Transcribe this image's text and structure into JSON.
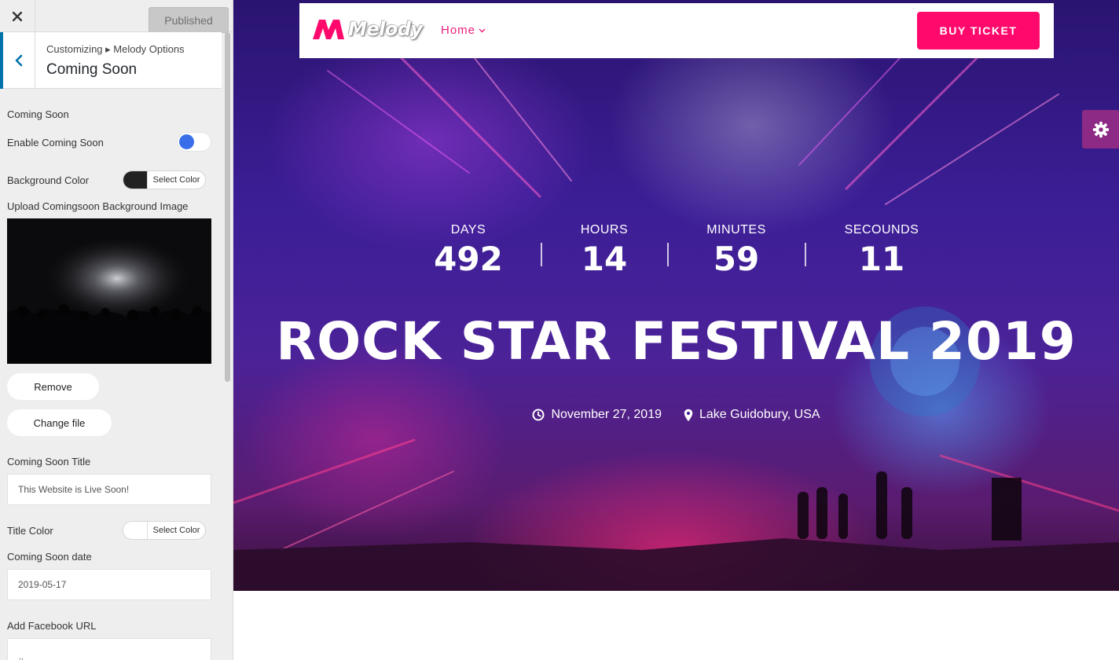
{
  "panel": {
    "publish_label": "Published",
    "breadcrumb": "Customizing ▸ Melody Options",
    "section_title": "Coming Soon",
    "controls": {
      "heading": "Coming Soon",
      "enable_label": "Enable Coming Soon",
      "enable_state": true,
      "bg_color_label": "Background Color",
      "select_color": "Select Color",
      "bg_color_value": "#222222",
      "upload_label": "Upload Comingsoon Background Image",
      "remove_label": "Remove",
      "change_file_label": "Change file",
      "title_label": "Coming Soon Title",
      "title_value": "This Website is Live Soon!",
      "title_color_label": "Title Color",
      "title_color_value": "#ffffff",
      "date_label": "Coming Soon date",
      "date_value": "2019-05-17",
      "facebook_label": "Add Facebook URL",
      "facebook_value": "#"
    }
  },
  "preview": {
    "logo_text": "Melody",
    "nav_home": "Home",
    "buy_ticket": "BUY TICKET",
    "countdown": [
      {
        "label": "DAYS",
        "value": "492"
      },
      {
        "label": "HOURS",
        "value": "14"
      },
      {
        "label": "MINUTES",
        "value": "59"
      },
      {
        "label": "SECOUNDS",
        "value": "11"
      }
    ],
    "event_title": "ROCK STAR FESTIVAL 2019",
    "event_date": "November 27, 2019",
    "event_location": "Lake Guidobury, USA"
  },
  "colors": {
    "accent_pink": "#ff0a6c",
    "nav_pink": "#ec1c7c",
    "toggle_blue": "#3a6ee8",
    "wp_blue": "#0073aa",
    "settings_purple": "#8c2a86"
  },
  "icons": {
    "close": "close-icon",
    "back": "chevron-left-icon",
    "settings": "gear-icon",
    "clock": "clock-icon",
    "location": "map-pin-icon",
    "dropdown": "chevron-down-icon"
  }
}
